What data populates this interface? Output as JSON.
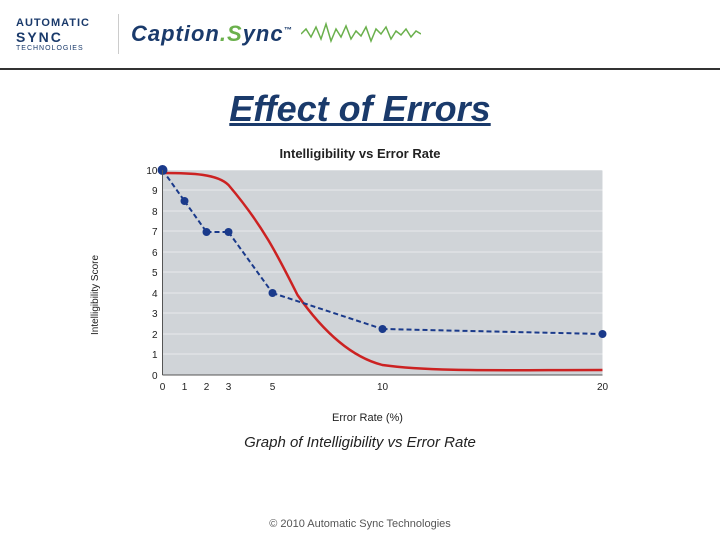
{
  "header": {
    "logo_auto": "AUTOMATIC",
    "logo_sync": "SYNC",
    "logo_tech": "TECHNOLOGIES",
    "logo_caption": "Caption",
    "logo_sync2": "Sync",
    "logo_tm": "™"
  },
  "page": {
    "title": "Effect of Errors",
    "chart_title": "Intelligibility vs Error Rate",
    "y_axis_label": "Intelligibility Score",
    "x_axis_label": "Error Rate (%)",
    "graph_caption": "Graph of Intelligibility vs Error Rate",
    "footer": "© 2010 Automatic Sync Technologies"
  },
  "chart": {
    "y_ticks": [
      "10",
      "9",
      "8",
      "7",
      "6",
      "5",
      "4",
      "3",
      "2",
      "1",
      "0"
    ],
    "x_ticks": [
      "0",
      "1",
      "2",
      "3",
      "5",
      "10",
      "20"
    ]
  }
}
